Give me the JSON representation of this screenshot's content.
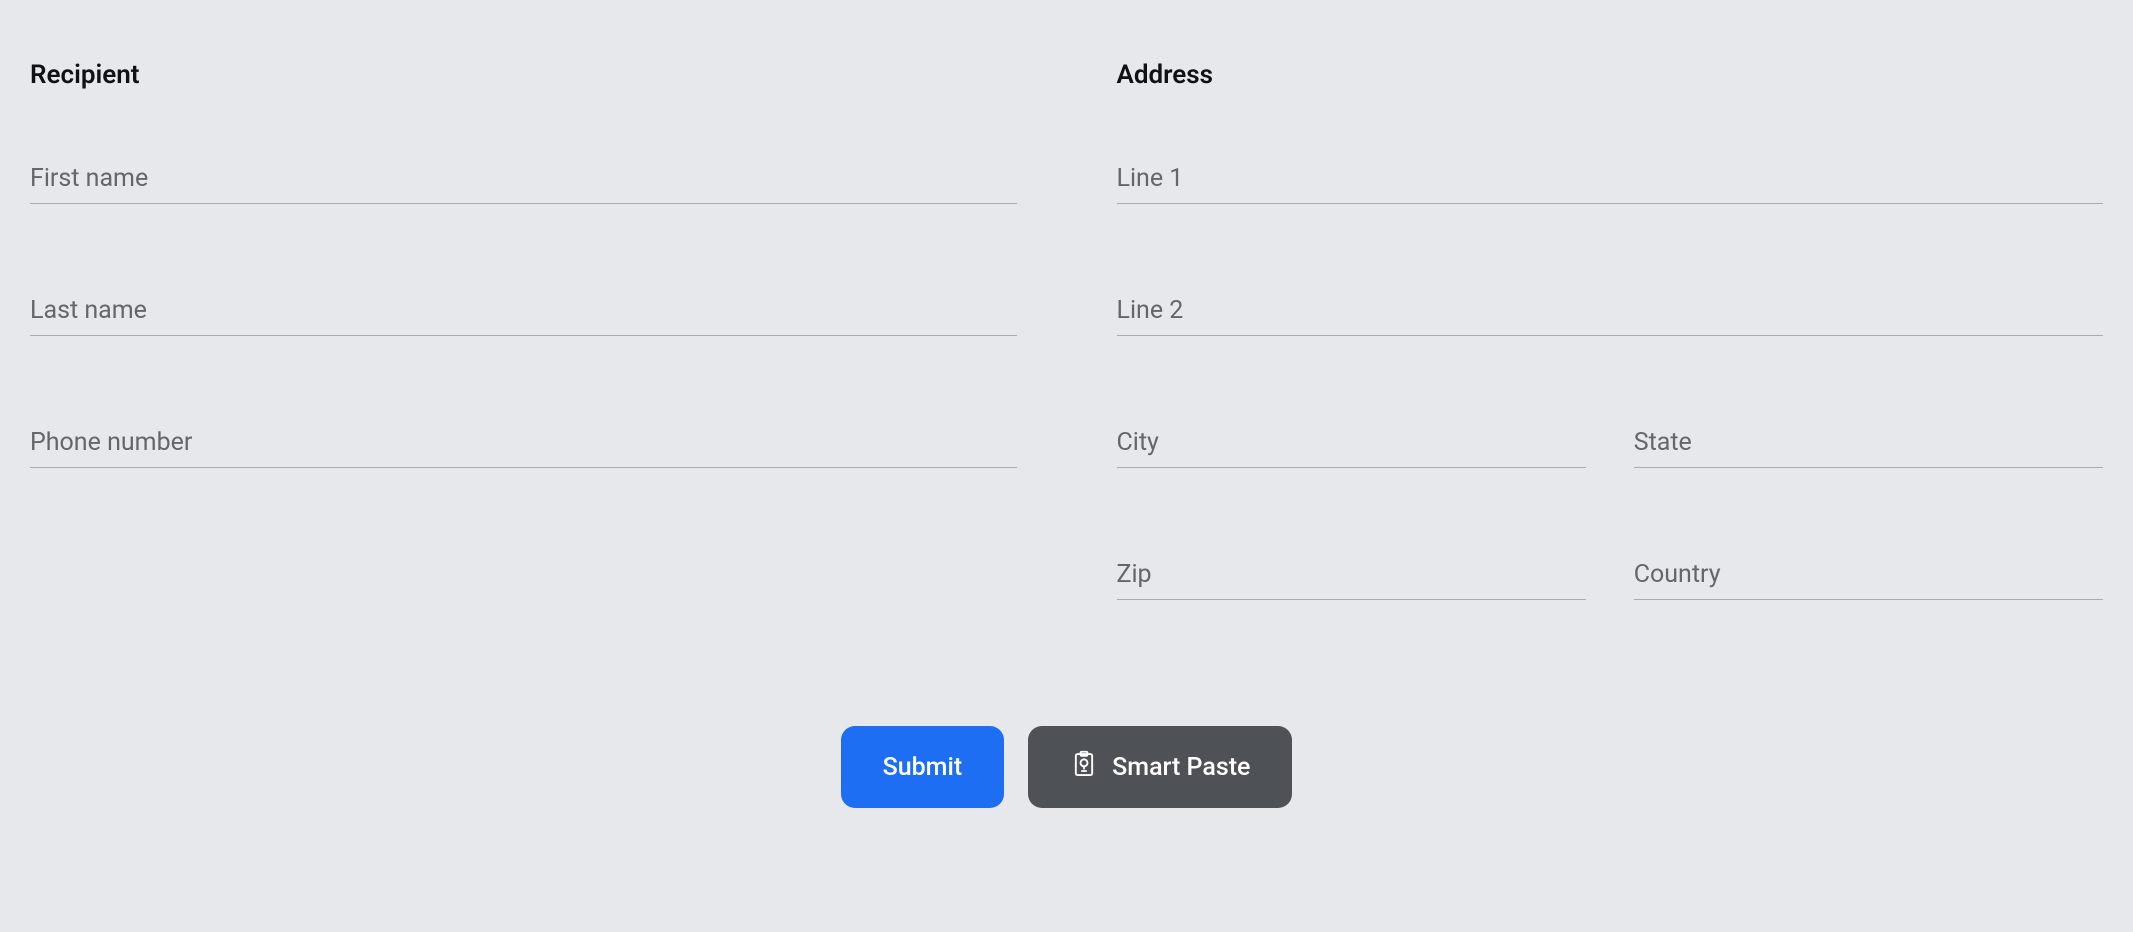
{
  "recipient": {
    "title": "Recipient",
    "fields": {
      "first_name": {
        "placeholder": "First name",
        "value": ""
      },
      "last_name": {
        "placeholder": "Last name",
        "value": ""
      },
      "phone": {
        "placeholder": "Phone number",
        "value": ""
      }
    }
  },
  "address": {
    "title": "Address",
    "fields": {
      "line1": {
        "placeholder": "Line 1",
        "value": ""
      },
      "line2": {
        "placeholder": "Line 2",
        "value": ""
      },
      "city": {
        "placeholder": "City",
        "value": ""
      },
      "state": {
        "placeholder": "State",
        "value": ""
      },
      "zip": {
        "placeholder": "Zip",
        "value": ""
      },
      "country": {
        "placeholder": "Country",
        "value": ""
      }
    }
  },
  "actions": {
    "submit_label": "Submit",
    "smart_paste_label": "Smart Paste"
  }
}
